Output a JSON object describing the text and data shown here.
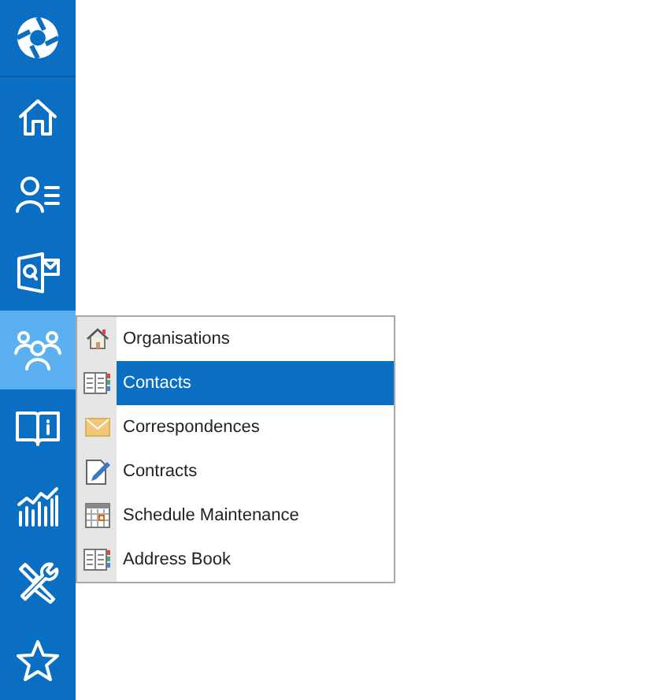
{
  "sidebar": {
    "items": [
      {
        "kind": "logo",
        "selected": false
      },
      {
        "kind": "home",
        "selected": false
      },
      {
        "kind": "person-list",
        "selected": false
      },
      {
        "kind": "mail-app",
        "selected": false
      },
      {
        "kind": "people",
        "selected": true
      },
      {
        "kind": "book",
        "selected": false
      },
      {
        "kind": "chart",
        "selected": false
      },
      {
        "kind": "tools",
        "selected": false
      },
      {
        "kind": "star",
        "selected": false
      }
    ]
  },
  "menu": {
    "items": [
      {
        "label": "Organisations",
        "kind": "house",
        "selected": false
      },
      {
        "label": "Contacts",
        "kind": "card",
        "selected": true
      },
      {
        "label": "Correspondences",
        "kind": "envelope",
        "selected": false
      },
      {
        "label": "Contracts",
        "kind": "document",
        "selected": false
      },
      {
        "label": "Schedule Maintenance",
        "kind": "calendar",
        "selected": false
      },
      {
        "label": "Address Book",
        "kind": "card",
        "selected": false
      }
    ]
  }
}
